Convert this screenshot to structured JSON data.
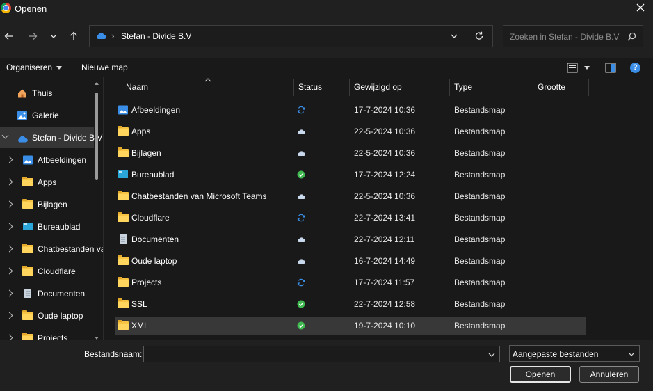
{
  "window": {
    "title": "Openen"
  },
  "address": {
    "location": "Stefan - Divide B.V",
    "separator": "›"
  },
  "search": {
    "placeholder": "Zoeken in Stefan - Divide B.V"
  },
  "commands": {
    "organize": "Organiseren",
    "new_folder": "Nieuwe map",
    "help": "?"
  },
  "nav_pane": [
    {
      "label": "Thuis",
      "icon": "home-icon",
      "chevron": "none"
    },
    {
      "label": "Galerie",
      "icon": "gallery-icon",
      "chevron": "none"
    },
    {
      "label": "Stefan - Divide B.V",
      "icon": "onedrive-cloud-icon",
      "chevron": "expanded",
      "selected": true
    },
    {
      "label": "Afbeeldingen",
      "icon": "pictures-icon",
      "chevron": "collapsed"
    },
    {
      "label": "Apps",
      "icon": "folder-icon",
      "chevron": "collapsed"
    },
    {
      "label": "Bijlagen",
      "icon": "folder-icon",
      "chevron": "collapsed"
    },
    {
      "label": "Bureaublad",
      "icon": "desktop-icon",
      "chevron": "collapsed"
    },
    {
      "label": "Chatbestanden van Microsoft Teams",
      "icon": "folder-icon",
      "chevron": "collapsed"
    },
    {
      "label": "Cloudflare",
      "icon": "folder-icon",
      "chevron": "collapsed"
    },
    {
      "label": "Documenten",
      "icon": "documents-icon",
      "chevron": "collapsed"
    },
    {
      "label": "Oude laptop",
      "icon": "folder-icon",
      "chevron": "collapsed"
    },
    {
      "label": "Projects",
      "icon": "folder-icon",
      "chevron": "collapsed"
    }
  ],
  "columns": {
    "name": "Naam",
    "status": "Status",
    "modified": "Gewijzigd op",
    "type": "Type",
    "size": "Grootte"
  },
  "files": [
    {
      "name": "Afbeeldingen",
      "icon": "pictures-icon",
      "status": "sync",
      "modified": "17-7-2024 10:36",
      "type": "Bestandsmap"
    },
    {
      "name": "Apps",
      "icon": "folder-icon",
      "status": "cloud",
      "modified": "22-5-2024 10:36",
      "type": "Bestandsmap"
    },
    {
      "name": "Bijlagen",
      "icon": "folder-icon",
      "status": "cloud",
      "modified": "22-5-2024 10:36",
      "type": "Bestandsmap"
    },
    {
      "name": "Bureaublad",
      "icon": "desktop-icon",
      "status": "available",
      "modified": "17-7-2024 12:24",
      "type": "Bestandsmap"
    },
    {
      "name": "Chatbestanden van Microsoft Teams",
      "icon": "folder-icon",
      "status": "cloud",
      "modified": "22-5-2024 10:36",
      "type": "Bestandsmap"
    },
    {
      "name": "Cloudflare",
      "icon": "folder-icon",
      "status": "sync",
      "modified": "22-7-2024 13:41",
      "type": "Bestandsmap"
    },
    {
      "name": "Documenten",
      "icon": "documents-icon",
      "status": "cloud",
      "modified": "22-7-2024 12:11",
      "type": "Bestandsmap"
    },
    {
      "name": "Oude laptop",
      "icon": "folder-icon",
      "status": "cloud",
      "modified": "16-7-2024 14:49",
      "type": "Bestandsmap"
    },
    {
      "name": "Projects",
      "icon": "folder-icon",
      "status": "sync",
      "modified": "17-7-2024 11:57",
      "type": "Bestandsmap"
    },
    {
      "name": "SSL",
      "icon": "folder-icon",
      "status": "available",
      "modified": "22-7-2024 12:58",
      "type": "Bestandsmap"
    },
    {
      "name": "XML",
      "icon": "folder-icon",
      "status": "available",
      "modified": "19-7-2024 10:10",
      "type": "Bestandsmap",
      "selected": true
    }
  ],
  "footer": {
    "filename_label": "Bestandsnaam:",
    "filename_value": "",
    "filetype_value": "Aangepaste bestanden",
    "open_label": "Openen",
    "cancel_label": "Annuleren"
  },
  "colors": {
    "sync": "#3a8ee6",
    "available": "#3fb950",
    "cloud": "#c8d9ee",
    "folder": "#f6c343"
  }
}
